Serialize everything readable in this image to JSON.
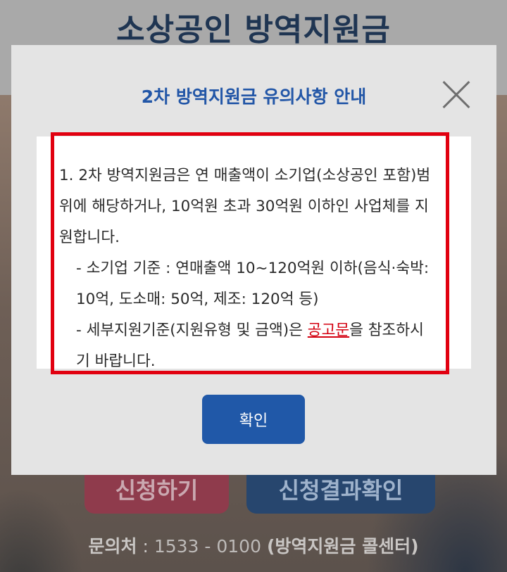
{
  "background": {
    "page_title": "소상공인 방역지원금",
    "apply_button_label": "신청하기",
    "result_button_label": "신청결과확인",
    "contact": {
      "label": "문의처",
      "separator": " : ",
      "number": "1533 - 0100",
      "center": "(방역지원금 콜센터)"
    }
  },
  "modal": {
    "title": "2차 방역지원금 유의사항 안내",
    "close_icon": "close-icon",
    "notice": {
      "paragraph1": "1. 2차 방역지원금은 연 매출액이 소기업(소상공인 포함)범위에 해당하거나, 10억원 초과 30억원 이하인 사업체를 지원합니다.",
      "item1": "- 소기업 기준 : 연매출액 10~120억원 이하(음식·숙박: 10억, 도소매: 50억, 제조: 120억 등)",
      "item2_before": "- 세부지원기준(지원유형 및 금액)은 ",
      "item2_link": "공고문",
      "item2_after": "을 참조하시기 바랍니다."
    },
    "confirm_label": "확인"
  },
  "colors": {
    "title_blue": "#2256a7",
    "highlight_red": "#e10010",
    "link_red": "#d40010",
    "confirm_blue": "#2058a8"
  }
}
